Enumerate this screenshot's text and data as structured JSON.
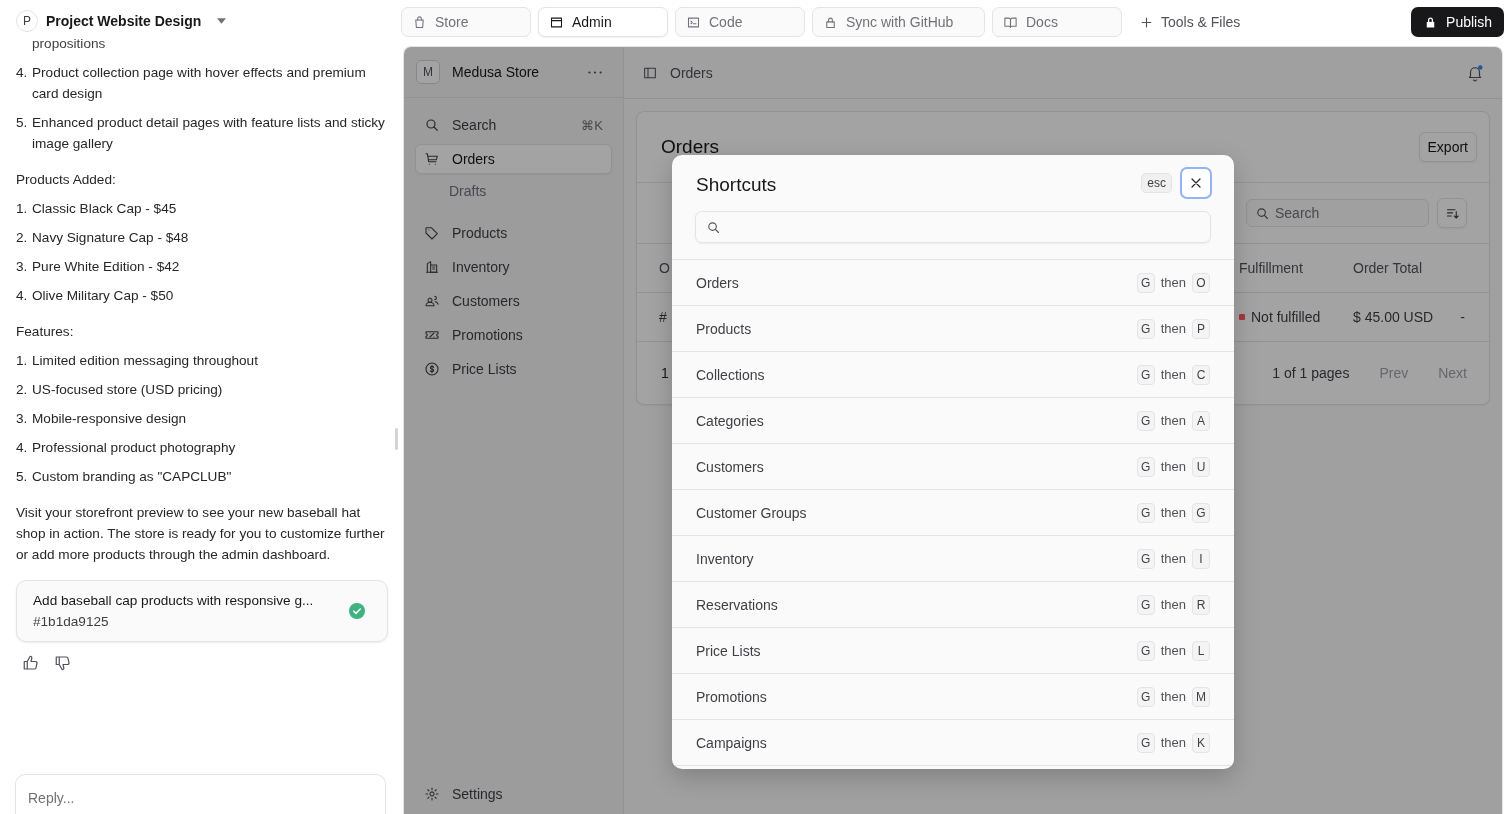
{
  "project": {
    "avatar": "P",
    "name": "Project Website Design"
  },
  "chat": [
    {
      "kind": "fragment",
      "text": "propositions"
    },
    {
      "kind": "list",
      "items": [
        {
          "number": "4.",
          "text": "Product collection page with hover effects and premium card design"
        },
        {
          "number": "5.",
          "text": "Enhanced product detail pages with feature lists and sticky image gallery"
        }
      ]
    },
    {
      "kind": "heading",
      "text": "Products Added:"
    },
    {
      "kind": "list",
      "items": [
        {
          "number": "1.",
          "text": "Classic Black Cap - $45"
        },
        {
          "number": "2.",
          "text": "Navy Signature Cap - $48"
        },
        {
          "number": "3.",
          "text": "Pure White Edition - $42"
        },
        {
          "number": "4.",
          "text": "Olive Military Cap - $50"
        }
      ]
    },
    {
      "kind": "heading",
      "text": "Features:"
    },
    {
      "kind": "list",
      "items": [
        {
          "number": "1.",
          "text": "Limited edition messaging throughout"
        },
        {
          "number": "2.",
          "text": "US-focused store (USD pricing)"
        },
        {
          "number": "3.",
          "text": "Mobile-responsive design"
        },
        {
          "number": "4.",
          "text": "Professional product photography"
        },
        {
          "number": "5.",
          "text": "Custom branding as \"CAPCLUB\""
        }
      ]
    },
    {
      "kind": "paragraph",
      "text": "Visit your storefront preview to see your new baseball hat shop in action. The store is ready for you to customize further or add more products through the admin dashboard."
    }
  ],
  "commit": {
    "title": "Add baseball cap products with responsive g...",
    "hash": "#1b1da9125",
    "done": true
  },
  "reply": {
    "placeholder": "Reply..."
  },
  "tabs": [
    {
      "label": "Store",
      "selected": false
    },
    {
      "label": "Admin",
      "selected": true
    },
    {
      "label": "Code",
      "selected": false
    },
    {
      "label": "Sync with GitHub",
      "selected": false
    },
    {
      "label": "Docs",
      "selected": false
    }
  ],
  "tools": {
    "label": "Tools & Files"
  },
  "publish": {
    "label": "Publish"
  },
  "admin": {
    "store": {
      "avatar": "M",
      "name": "Medusa Store"
    },
    "search": {
      "label": "Search",
      "shortcut": "⌘K"
    },
    "nav": [
      {
        "label": "Orders",
        "selected": true,
        "children": [
          {
            "label": "Drafts",
            "selected": false
          }
        ]
      },
      {
        "label": "Products",
        "selected": false
      },
      {
        "label": "Inventory",
        "selected": false
      },
      {
        "label": "Customers",
        "selected": false
      },
      {
        "label": "Promotions",
        "selected": false
      },
      {
        "label": "Price Lists",
        "selected": false
      }
    ],
    "settings": {
      "label": "Settings"
    },
    "breadcrumb": "Orders",
    "notifications": true,
    "orders": {
      "title": "Orders",
      "export": "Export",
      "search": {
        "placeholder": "Search"
      },
      "columns": [
        "O",
        "Fulfillment",
        "Order Total"
      ],
      "rows": [
        {
          "id": "#",
          "fulfillment": "Not fulfilled",
          "color": "#a13a3c",
          "total": "$ 45.00 USD",
          "extra": "-"
        }
      ],
      "footer": {
        "count": "1",
        "pages": "1 of 1 pages",
        "prev": {
          "label": "Prev",
          "disabled": true
        },
        "next": {
          "label": "Next",
          "disabled": true
        }
      }
    }
  },
  "modal": {
    "title": "Shortcuts",
    "esc": "esc",
    "shortcuts": [
      {
        "label": "Orders",
        "keys": [
          "G",
          "O"
        ],
        "joiner": "then"
      },
      {
        "label": "Products",
        "keys": [
          "G",
          "P"
        ],
        "joiner": "then"
      },
      {
        "label": "Collections",
        "keys": [
          "G",
          "C"
        ],
        "joiner": "then"
      },
      {
        "label": "Categories",
        "keys": [
          "G",
          "A"
        ],
        "joiner": "then"
      },
      {
        "label": "Customers",
        "keys": [
          "G",
          "U"
        ],
        "joiner": "then"
      },
      {
        "label": "Customer Groups",
        "keys": [
          "G",
          "G"
        ],
        "joiner": "then"
      },
      {
        "label": "Inventory",
        "keys": [
          "G",
          "I"
        ],
        "joiner": "then"
      },
      {
        "label": "Reservations",
        "keys": [
          "G",
          "R"
        ],
        "joiner": "then"
      },
      {
        "label": "Price Lists",
        "keys": [
          "G",
          "L"
        ],
        "joiner": "then"
      },
      {
        "label": "Promotions",
        "keys": [
          "G",
          "M"
        ],
        "joiner": "then"
      },
      {
        "label": "Campaigns",
        "keys": [
          "G",
          "K"
        ],
        "joiner": "then"
      }
    ]
  }
}
